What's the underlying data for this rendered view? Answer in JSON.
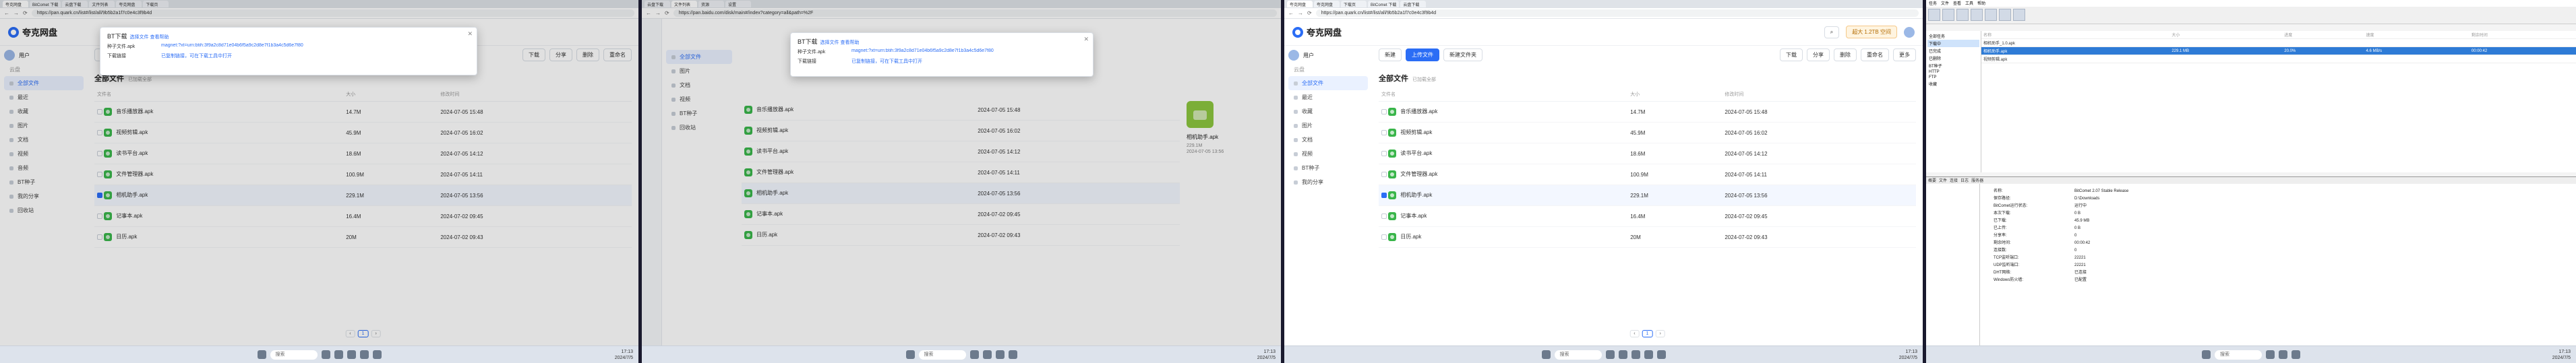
{
  "browser": {
    "tabs": [
      "夸克网盘",
      "BitComet 下载",
      "云盘下载",
      "文件列表",
      "夸克网盘",
      "下载页",
      "资源",
      "设置"
    ],
    "url_primary": "https://pan.quark.cn/list#/list/all/9b5b2a1f7c0e4c3f9b4d",
    "url_secondary": "https://pan.baidu.com/disk/main#/index?category=all&path=%2F"
  },
  "app": {
    "name": "夸克网盘",
    "user": "用户",
    "storage_label": "超大 1.2TB 空间"
  },
  "sidebar": {
    "section_files": "云盘",
    "items": [
      "全部文件",
      "最近",
      "收藏",
      "图片",
      "文档",
      "视频",
      "音频",
      "BT种子",
      "我的分享",
      "回收站"
    ]
  },
  "toolbar": {
    "upload_label": "上传文件",
    "new_folder_label": "新建文件夹",
    "new_label": "新建",
    "download_label": "下载",
    "share_label": "分享",
    "delete_label": "删除",
    "rename_label": "重命名",
    "more_label": "更多"
  },
  "main": {
    "title": "全部文件",
    "subtitle": "已加载全部",
    "columns": [
      "文件名",
      "大小",
      "修改时间"
    ],
    "rows": [
      {
        "name": "音乐播放器.apk",
        "size": "14.7M",
        "time": "2024-07-05 15:48"
      },
      {
        "name": "视频剪辑.apk",
        "size": "45.9M",
        "time": "2024-07-05 16:02"
      },
      {
        "name": "读书平台.apk",
        "size": "18.6M",
        "time": "2024-07-05 14:12"
      },
      {
        "name": "文件管理器.apk",
        "size": "100.9M",
        "time": "2024-07-05 14:11"
      },
      {
        "name": "相机助手.apk",
        "size": "229.1M",
        "time": "2024-07-05 13:56"
      },
      {
        "name": "记事本.apk",
        "size": "16.4M",
        "time": "2024-07-02 09:45"
      },
      {
        "name": "日历.apk",
        "size": "20M",
        "time": "2024-07-02 09:43"
      }
    ],
    "page": "1"
  },
  "dialog": {
    "title": "BT下载",
    "hint": "选择文件 查看帮助",
    "file_label": "种子文件.apk",
    "file_value": "magnet:?xt=urn:btih:3f9a2c8d71e04b6f5a9c2d8e7f1b3a4c5d6e7f80",
    "link_label": "下载链接",
    "link_value": "已复制链接，可在下载工具中打开"
  },
  "taskbar": {
    "search_placeholder": "搜索",
    "time": "17:13",
    "date": "2024/7/5"
  },
  "idm": {
    "menu": [
      "任务",
      "文件",
      "查看",
      "工具",
      "帮助"
    ],
    "tree": [
      "全部任务",
      "下载中",
      "已完成",
      "已删除",
      "BT种子",
      "HTTP",
      "FTP",
      "收藏"
    ],
    "list_columns": [
      "名称",
      "大小",
      "进度",
      "速度",
      "剩余时间"
    ],
    "list_rows": [
      {
        "name": "相机助手_1.0.apk",
        "size": "",
        "progress": "",
        "speed": "",
        "eta": ""
      },
      {
        "name": "相机助手.apk",
        "size": "229.1 MB",
        "progress": "20.0%",
        "speed": "4.6 MB/s",
        "eta": "00:00:42"
      },
      {
        "name": "视频剪辑.apk",
        "size": "",
        "progress": "",
        "speed": "",
        "eta": ""
      }
    ],
    "prop_tabs": [
      "概要",
      "文件",
      "连接",
      "日志",
      "服务器"
    ],
    "props": [
      {
        "k": "名称:",
        "v": "BitComet 2.07 Stable Release"
      },
      {
        "k": "保存路径:",
        "v": "D:\\Downloads"
      },
      {
        "k": "BitComet运行状态:",
        "v": "运行中"
      },
      {
        "k": "本次下载:",
        "v": "0 B"
      },
      {
        "k": "已下载:",
        "v": "45.9 MB"
      },
      {
        "k": "已上传:",
        "v": "0 B"
      },
      {
        "k": "分享率:",
        "v": "0"
      },
      {
        "k": "剩余时间:",
        "v": "00:00:42"
      },
      {
        "k": "连接数:",
        "v": "0"
      },
      {
        "k": "TCP监听端口:",
        "v": "22221"
      },
      {
        "k": "UDP监听端口:",
        "v": "22221"
      },
      {
        "k": "DHT网络:",
        "v": "已连接"
      },
      {
        "k": "Windows防火墙:",
        "v": "已配置"
      }
    ]
  },
  "preview": {
    "name": "相机助手.apk",
    "size": "229.1M",
    "time": "2024-07-05 13:56"
  }
}
